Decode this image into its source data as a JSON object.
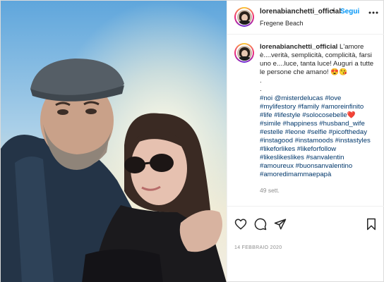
{
  "post": {
    "username": "lorenabianchetti_official",
    "separator": "•",
    "follow_label": "Segui",
    "location": "Fregene Beach",
    "more_icon": "more-horizontal-icon",
    "caption_lines": [
      "L'amore",
      "è....verità, semplicità, complicità, farsi",
      "uno e....luce, tanta luce! Auguri a tutte",
      "le persone che amano! 😍😘",
      ".",
      "."
    ],
    "hashtag_lines": [
      "#noi @misterdelucas #love",
      "#mylifestory #family #amoreinfinito",
      "#life #lifestyle #solocosebelle❤️",
      "#simile #happiness #husband_wife",
      "#estelle #leone #selfie #picoftheday",
      "#instagood #instamoods #instastyles",
      "#likeforlikes #likeforfollow",
      "#likeslikeslikes #sanvalentin",
      "#amoureux #buonsanvalentino",
      "#amoredimammaepapà"
    ],
    "time_ago": "49 sett.",
    "date": "14 FEBBRAIO 2020"
  },
  "actions": {
    "like_icon": "heart-icon",
    "comment_icon": "comment-icon",
    "share_icon": "share-icon",
    "save_icon": "bookmark-icon"
  },
  "colors": {
    "accent": "#0095f6",
    "hashtag": "#00376b",
    "muted": "#8e8e8e",
    "text": "#262626"
  }
}
